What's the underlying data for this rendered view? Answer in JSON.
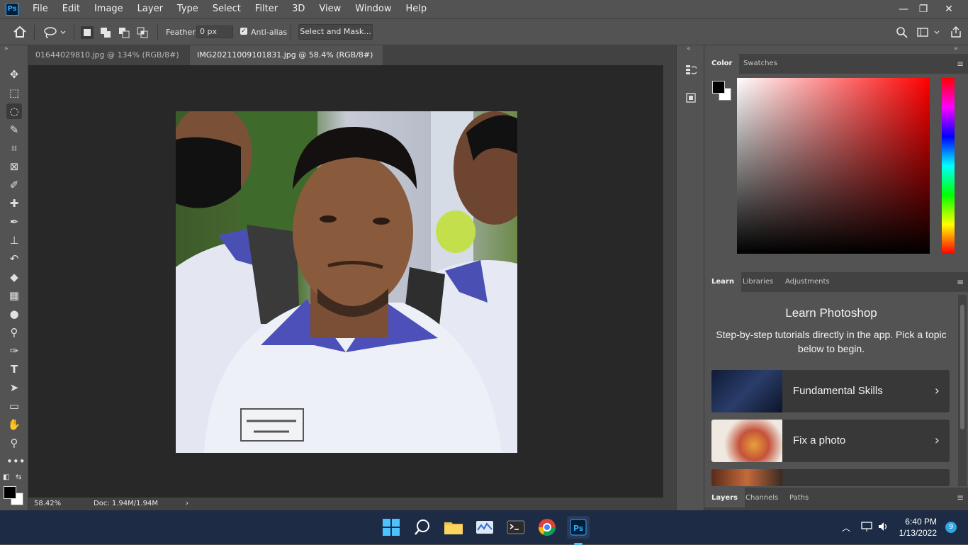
{
  "app": {
    "logo_text": "Ps"
  },
  "menu": [
    "File",
    "Edit",
    "Image",
    "Layer",
    "Type",
    "Select",
    "Filter",
    "3D",
    "View",
    "Window",
    "Help"
  ],
  "window_controls": {
    "minimize": "—",
    "restore": "❐",
    "close": "✕"
  },
  "options": {
    "feather_label": "Feather:",
    "feather_value": "0 px",
    "antialias_label": "Anti-alias",
    "select_mask_label": "Select and Mask..."
  },
  "documents": [
    {
      "title": "01644029810.jpg @ 134% (RGB/8#) *",
      "active": false
    },
    {
      "title": "IMG20211009101831.jpg @ 58.4% (RGB/8#) *",
      "active": true
    }
  ],
  "status": {
    "zoom": "58.42%",
    "doc": "Doc: 1.94M/1.94M",
    "arrow": "›"
  },
  "color_panel": {
    "tabs": [
      "Color",
      "Swatches"
    ],
    "active": "Color"
  },
  "learn_panel": {
    "tabs": [
      "Learn",
      "Libraries",
      "Adjustments"
    ],
    "title": "Learn Photoshop",
    "description": "Step-by-step tutorials directly in the app. Pick a topic below to begin.",
    "cards": [
      {
        "label": "Fundamental Skills"
      },
      {
        "label": "Fix a photo"
      },
      {
        "label": ""
      }
    ]
  },
  "layers_panel": {
    "tabs": [
      "Layers",
      "Channels",
      "Paths"
    ]
  },
  "taskbar": {
    "time": "6:40 PM",
    "date": "1/13/2022",
    "notifications": "9"
  },
  "colors": {
    "accent": "#31a8ff",
    "bg": "#535353",
    "canvas": "#282828"
  }
}
